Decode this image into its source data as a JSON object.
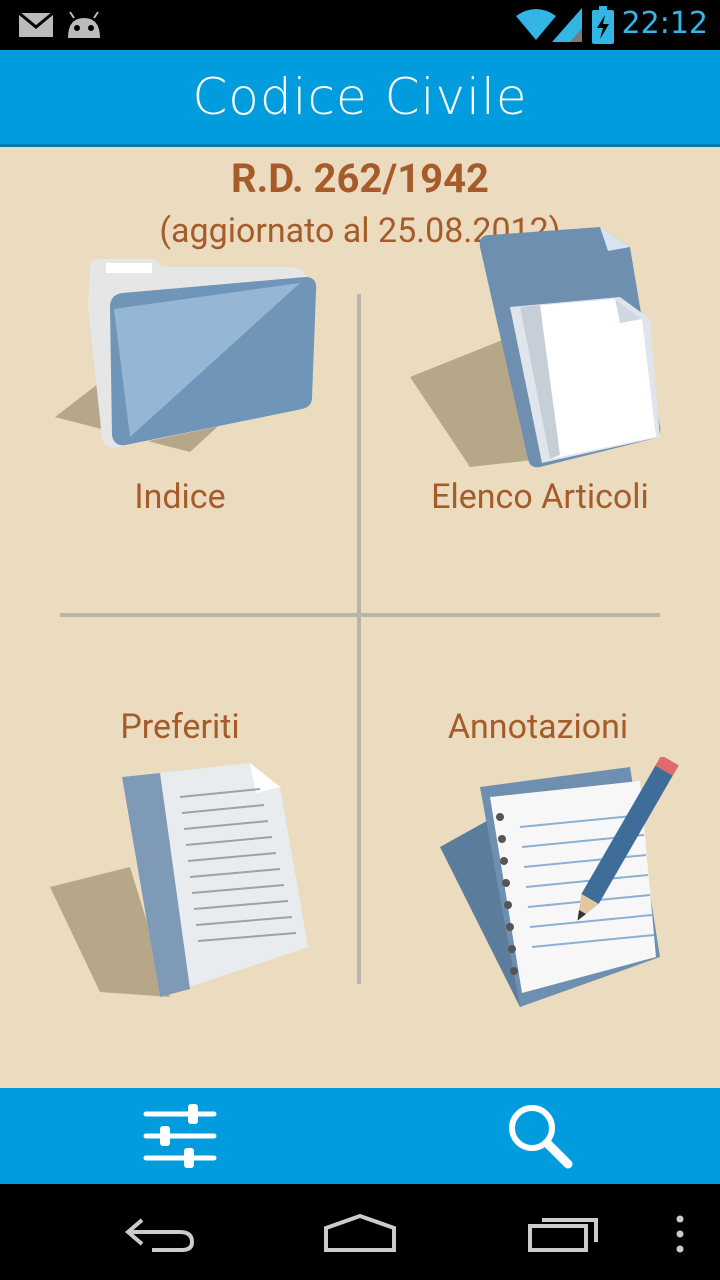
{
  "status_bar": {
    "time": "22:12",
    "icons": [
      "gmail-icon",
      "android-icon",
      "wifi-icon",
      "signal-icon",
      "battery-charging-icon"
    ]
  },
  "action_bar": {
    "title": "Codice Civile"
  },
  "header": {
    "law": "R.D. 262/1942",
    "updated": "(aggiornato al 25.08.2012)"
  },
  "tiles": [
    {
      "label": "Indice",
      "icon": "folder-icon"
    },
    {
      "label": "Elenco Articoli",
      "icon": "documents-icon"
    },
    {
      "label": "Preferiti",
      "icon": "document-icon"
    },
    {
      "label": "Annotazioni",
      "icon": "notepad-pencil-icon"
    }
  ],
  "bottom_bar": {
    "icons": [
      "settings-sliders-icon",
      "search-icon"
    ]
  },
  "nav_bar": {
    "icons": [
      "back-icon",
      "home-icon",
      "recent-apps-icon",
      "overflow-menu-icon"
    ]
  },
  "colors": {
    "accent": "#009cde",
    "background": "#ebdbbf",
    "label": "#a55b2a"
  }
}
